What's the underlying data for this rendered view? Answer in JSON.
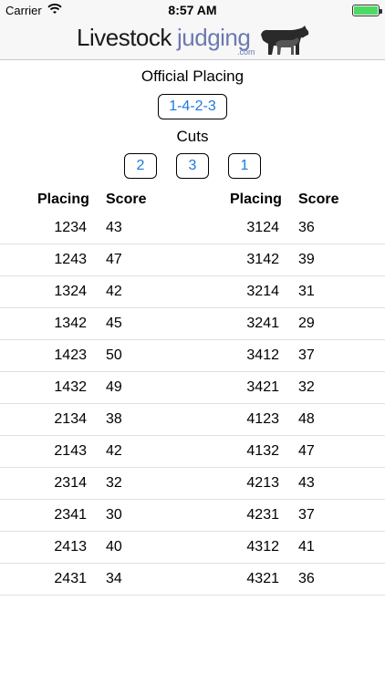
{
  "status_bar": {
    "carrier": "Carrier",
    "time": "8:57 AM",
    "icons": [
      "wifi-icon",
      "battery-icon"
    ]
  },
  "header": {
    "logo_text_main": "Livestock",
    "logo_text_accent": "judging",
    "logo_text_domain": ".com",
    "logo_icon": "livestock-animals-icon",
    "colors": {
      "accent": "#6b7ab0",
      "link": "#1a7be0"
    }
  },
  "official": {
    "title": "Official Placing",
    "placing": "1-4-2-3"
  },
  "cuts": {
    "title": "Cuts",
    "values": [
      "2",
      "3",
      "1"
    ]
  },
  "table": {
    "headers": {
      "placing": "Placing",
      "score": "Score"
    },
    "rows": [
      {
        "left_placing": "1234",
        "left_score": "43",
        "right_placing": "3124",
        "right_score": "36"
      },
      {
        "left_placing": "1243",
        "left_score": "47",
        "right_placing": "3142",
        "right_score": "39"
      },
      {
        "left_placing": "1324",
        "left_score": "42",
        "right_placing": "3214",
        "right_score": "31"
      },
      {
        "left_placing": "1342",
        "left_score": "45",
        "right_placing": "3241",
        "right_score": "29"
      },
      {
        "left_placing": "1423",
        "left_score": "50",
        "right_placing": "3412",
        "right_score": "37"
      },
      {
        "left_placing": "1432",
        "left_score": "49",
        "right_placing": "3421",
        "right_score": "32"
      },
      {
        "left_placing": "2134",
        "left_score": "38",
        "right_placing": "4123",
        "right_score": "48"
      },
      {
        "left_placing": "2143",
        "left_score": "42",
        "right_placing": "4132",
        "right_score": "47"
      },
      {
        "left_placing": "2314",
        "left_score": "32",
        "right_placing": "4213",
        "right_score": "43"
      },
      {
        "left_placing": "2341",
        "left_score": "30",
        "right_placing": "4231",
        "right_score": "37"
      },
      {
        "left_placing": "2413",
        "left_score": "40",
        "right_placing": "4312",
        "right_score": "41"
      },
      {
        "left_placing": "2431",
        "left_score": "34",
        "right_placing": "4321",
        "right_score": "36"
      }
    ]
  }
}
